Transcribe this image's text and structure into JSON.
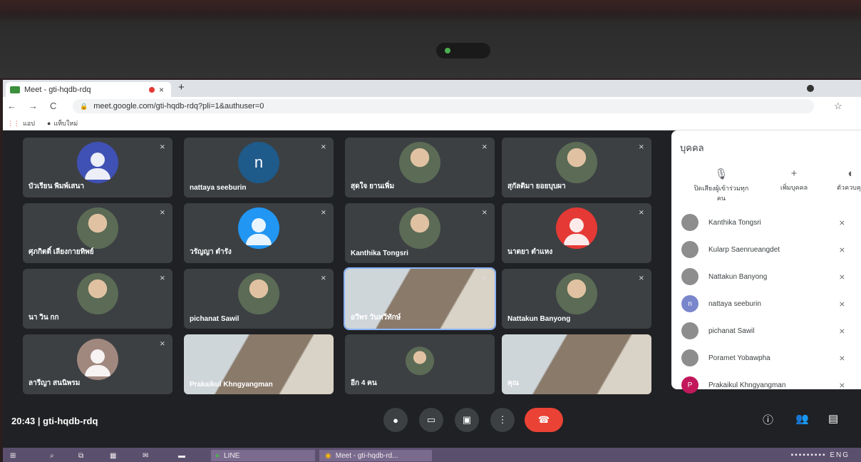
{
  "browser": {
    "tab_title": "Meet - gti-hqdb-rdq",
    "tab_close": "×",
    "new_tab": "+",
    "url": "meet.google.com/gti-hqdb-rdq?pli=1&authuser=0",
    "bookmarks": [
      "แอป",
      "แท็บใหม่"
    ]
  },
  "tiles": [
    {
      "name": "บัวเรียน พิมพ์เสนา",
      "avatar": "",
      "color": "#3f51b5"
    },
    {
      "name": "nattaya seeburin",
      "avatar": "n",
      "color": "#1e5a8a"
    },
    {
      "name": "สุดใจ ยานเพิ่ม",
      "avatar": "",
      "color": "photo"
    },
    {
      "name": "สุกัลติมา ยอยบุบผา",
      "avatar": "",
      "color": "photo"
    },
    {
      "name": "ศุภกิตติ์ เลียงกายทิพย์",
      "avatar": "",
      "color": "photo"
    },
    {
      "name": "วรัญญา ตำรัง",
      "avatar": "",
      "color": "#2196f3"
    },
    {
      "name": "Kanthika Tongsri",
      "avatar": "",
      "color": "photo"
    },
    {
      "name": "นาตยา ตำแหง",
      "avatar": "",
      "color": "#e53935"
    },
    {
      "name": "นา วิน กก",
      "avatar": "",
      "color": "photo"
    },
    {
      "name": "pichanat Sawil",
      "avatar": "",
      "color": "photo"
    },
    {
      "name": "อวีพร วันทวีทักษ์",
      "avatar": "",
      "color": "video"
    },
    {
      "name": "Nattakun Banyong",
      "avatar": "",
      "color": "photo"
    },
    {
      "name": "ลารีญา สนนิพรม",
      "avatar": "",
      "color": "#a1887f"
    },
    {
      "name": "Prakaikul Khngyangman",
      "avatar": "",
      "color": "video"
    },
    {
      "name": "อีก 4 คน",
      "avatar": "",
      "color": "group"
    },
    {
      "name": "คุณ",
      "avatar": "",
      "color": "video"
    }
  ],
  "panel": {
    "title": "บุคคล",
    "actions": [
      "ปิดเสียงผู้เข้าร่วมทุกคน",
      "เพิ่มบุคคล",
      "ตัวควบคุม"
    ],
    "people": [
      {
        "name": "Kanthika Tongsri",
        "initial": ""
      },
      {
        "name": "Kularp Saenrueangdet",
        "initial": ""
      },
      {
        "name": "Nattakun Banyong",
        "initial": ""
      },
      {
        "name": "nattaya seeburin",
        "initial": "n"
      },
      {
        "name": "pichanat Sawil",
        "initial": ""
      },
      {
        "name": "Poramet Yobawpha",
        "initial": ""
      },
      {
        "name": "Prakaikul Khngyangman",
        "initial": "P"
      }
    ]
  },
  "meeting": {
    "time": "20:43",
    "separator": "|",
    "code": "gti-hqdb-rdq"
  },
  "taskbar": {
    "line": "LINE",
    "meet": "Meet - gti-hqdb-rd...",
    "lang": "ENG"
  }
}
